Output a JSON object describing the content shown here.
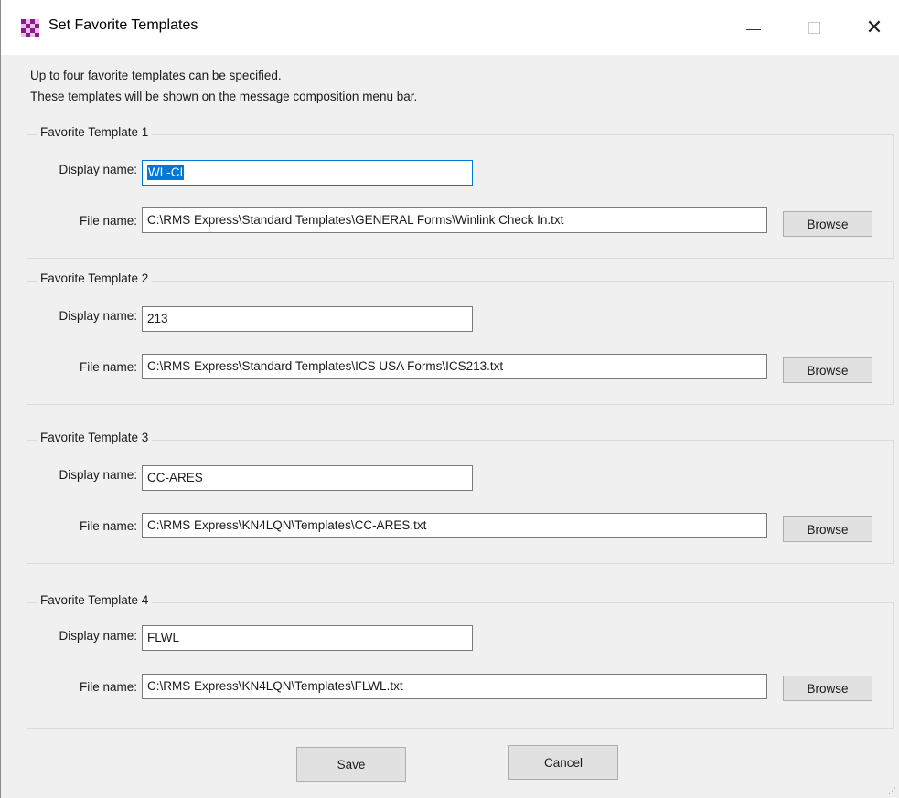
{
  "window": {
    "title": "Set Favorite Templates",
    "icon": "checkerboard-icon",
    "close_symbol": "✕"
  },
  "intro": {
    "line1": "Up to four favorite templates can be specified.",
    "line2": "These templates will be shown on the message composition menu bar."
  },
  "labels": {
    "display_name": "Display name:",
    "file_name": "File name:",
    "browse": "Browse"
  },
  "templates": [
    {
      "group_title": "Favorite Template 1",
      "display_name": "WL-CI",
      "file_name": "C:\\RMS Express\\Standard Templates\\GENERAL Forms\\Winlink Check In.txt"
    },
    {
      "group_title": "Favorite Template 2",
      "display_name": "213",
      "file_name": "C:\\RMS Express\\Standard Templates\\ICS USA Forms\\ICS213.txt"
    },
    {
      "group_title": "Favorite Template 3",
      "display_name": "CC-ARES",
      "file_name": "C:\\RMS Express\\KN4LQN\\Templates\\CC-ARES.txt"
    },
    {
      "group_title": "Favorite Template 4",
      "display_name": "FLWL",
      "file_name": "C:\\RMS Express\\KN4LQN\\Templates\\FLWL.txt"
    }
  ],
  "footer": {
    "save_label": "Save",
    "cancel_label": "Cancel"
  },
  "colors": {
    "selection": "#0078d7",
    "focus_border": "#0078d7",
    "button_face": "#e1e1e1"
  }
}
